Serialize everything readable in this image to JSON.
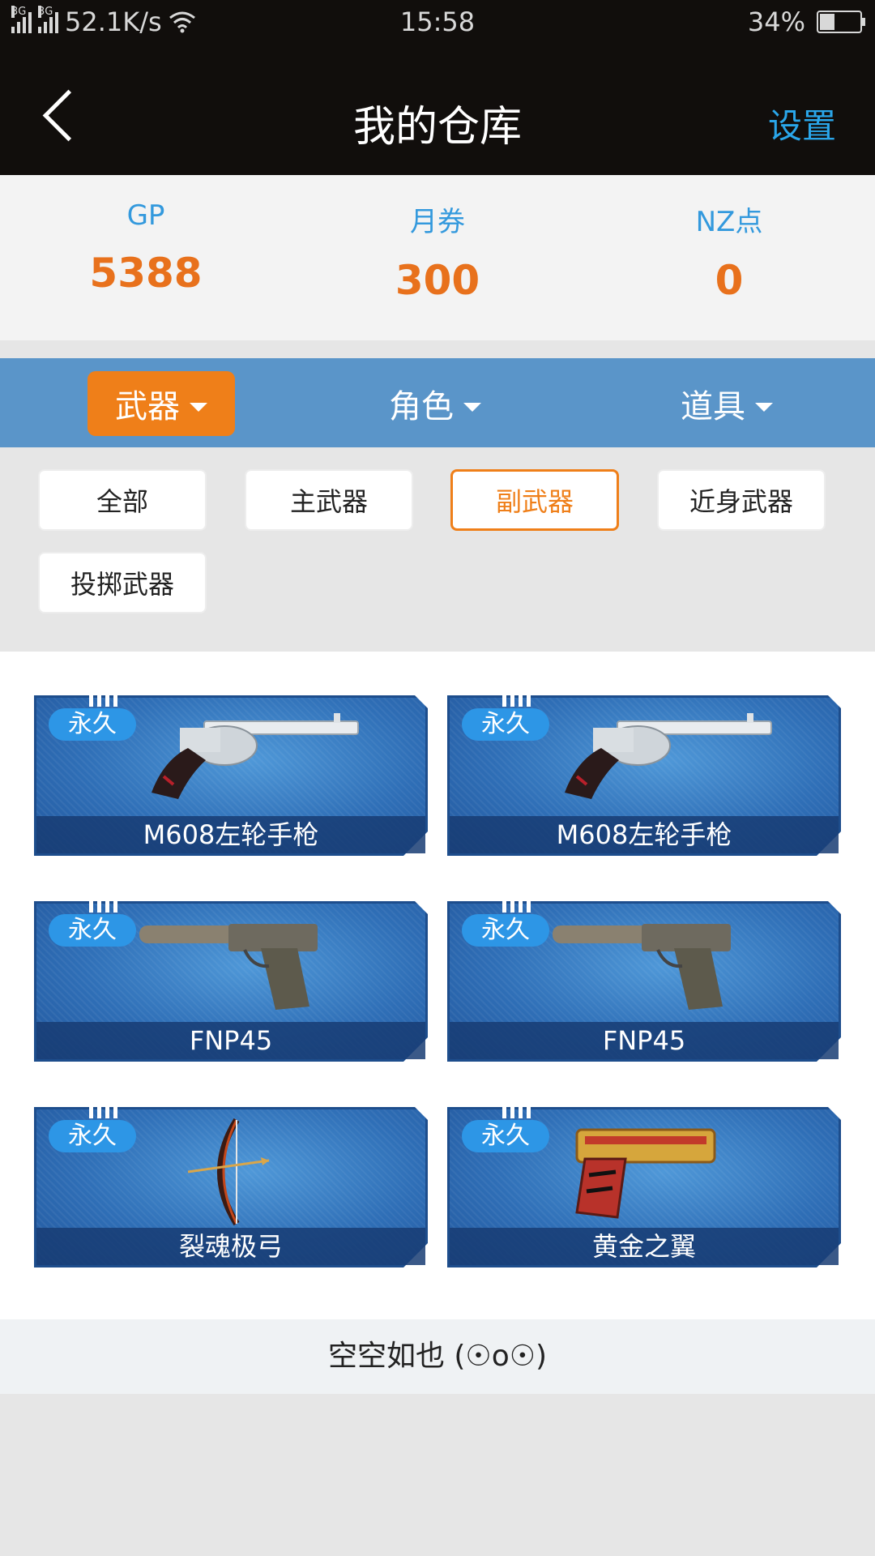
{
  "status_bar": {
    "network1": "3G",
    "network2": "3G",
    "speed": "52.1K/s",
    "time": "15:58",
    "battery": "34%"
  },
  "header": {
    "title": "我的仓库",
    "settings": "设置"
  },
  "currencies": [
    {
      "label": "GP",
      "value": "5388"
    },
    {
      "label": "月券",
      "value": "300"
    },
    {
      "label": "NZ点",
      "value": "0"
    }
  ],
  "categories": [
    {
      "label": "武器",
      "active": true
    },
    {
      "label": "角色",
      "active": false
    },
    {
      "label": "道具",
      "active": false
    }
  ],
  "filters": [
    {
      "label": "全部"
    },
    {
      "label": "主武器"
    },
    {
      "label": "副武器",
      "active": true
    },
    {
      "label": "近身武器"
    },
    {
      "label": "投掷武器"
    }
  ],
  "items": [
    {
      "tag": "永久",
      "name": "M608左轮手枪",
      "icon": "revolver-icon"
    },
    {
      "tag": "永久",
      "name": "M608左轮手枪",
      "icon": "revolver-icon"
    },
    {
      "tag": "永久",
      "name": "FNP45",
      "icon": "pistol-silencer-icon"
    },
    {
      "tag": "永久",
      "name": "FNP45",
      "icon": "pistol-silencer-icon"
    },
    {
      "tag": "永久",
      "name": "裂魂极弓",
      "icon": "bow-icon"
    },
    {
      "tag": "永久",
      "name": "黄金之翼",
      "icon": "gold-pistol-icon"
    }
  ],
  "empty_text": "空空如也 (☉o☉)",
  "colors": {
    "accent_orange": "#ef7f19",
    "accent_blue": "#2aa6ea",
    "category_bar": "#5a95c9"
  }
}
